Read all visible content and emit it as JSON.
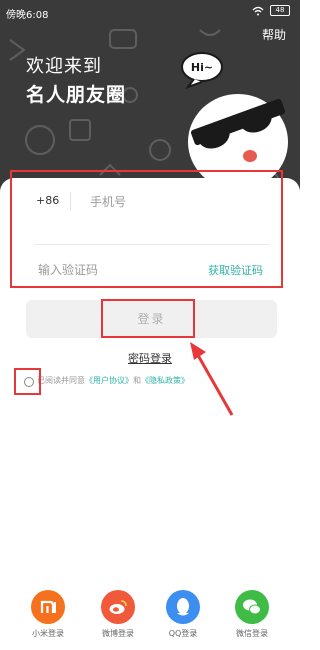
{
  "status_bar": {
    "time": "傍晚6:08",
    "battery": "48"
  },
  "header": {
    "help_label": "帮助",
    "welcome_line1": "欢迎来到",
    "welcome_line2": "名人朋友圈",
    "mascot_bubble": "Hi~"
  },
  "form": {
    "country_code": "+86",
    "phone_placeholder": "手机号",
    "phone_value": "",
    "code_placeholder": "输入验证码",
    "code_value": "",
    "get_code_label": "获取验证码",
    "login_label": "登录",
    "password_login_label": "密码登录"
  },
  "agreement": {
    "prefix": "已阅读并同意",
    "user_agreement": "《用户协议》",
    "and": "和",
    "privacy_policy": "《隐私政策》",
    "checked": false
  },
  "social_login": [
    {
      "label": "小米登录",
      "color": "#f6711d",
      "icon": "xiaomi-icon"
    },
    {
      "label": "微博登录",
      "color": "#f0593a",
      "icon": "weibo-icon"
    },
    {
      "label": "QQ登录",
      "color": "#3c8ff0",
      "icon": "qq-icon"
    },
    {
      "label": "微信登录",
      "color": "#3fbc45",
      "icon": "wechat-icon"
    }
  ],
  "colors": {
    "accent": "#2fb3a6",
    "annotation": "#e8373b",
    "header_bg": "#3a3a3a"
  }
}
